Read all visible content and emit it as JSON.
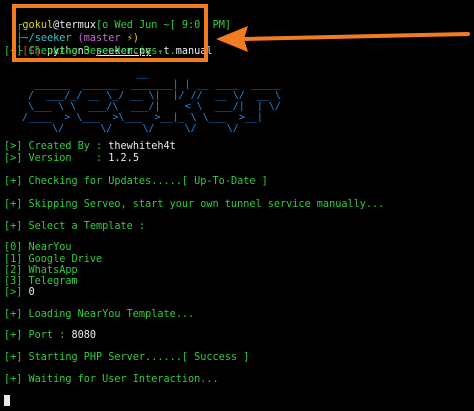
{
  "prompt": {
    "line1_user": "gokul",
    "line1_host": "@termux",
    "line1_time": "[o Wed Jun ~[ 9:0  PM]",
    "line2_path": "~/seeker",
    "line2_branch": "(master",
    "line2_flag": "⚡)",
    "line3_symbol": "[$]",
    "line3_cmd_prefix": " python3 ",
    "line3_cmd_file": "seeker.py",
    "line3_cmd_args": " -t manual"
  },
  "output": {
    "checking_deps": "[+] Checking Dependencies...",
    "banner": "                      __\n     ______  ______  _______| | __ ____  _____\n    /  ___/_/ __ \\_/ __ \\|  |/ //  __ \\/  __ \\\n    \\___ \\ \\  ___/\\  ___/|    < \\  ___/|  | \\/\n   /____  > \\___  >\\___  >__|_ \\ \\___  >__|\n        \\/      \\/     \\/     \\/     \\/",
    "created_by_label": "[>] Created By : ",
    "created_by_value": "thewhiteh4t",
    "version_label": "[>] Version    : ",
    "version_value": "1.2.5",
    "updates_prefix": "[+] Checking for Updates.....",
    "updates_status": "[ Up-To-Date ]",
    "serveo_msg": "[+] Skipping Serveo, start your own tunnel service manually...",
    "select_template": "[+] Select a Template :",
    "templates": [
      "[0] NearYou",
      "[1] Google Drive",
      "[2] WhatsApp",
      "[3] Telegram"
    ],
    "template_choice_prompt": "[>] ",
    "template_choice_value": "0",
    "loading_template": "[+] Loading NearYou Template...",
    "port_label": "[+] Port : ",
    "port_value": "8080",
    "php_prefix": "[+] Starting PHP Server......",
    "php_status": "[ Success ]",
    "waiting": "[+] Waiting for User Interaction..."
  },
  "annotation": {
    "box_color": "#f47c20"
  }
}
